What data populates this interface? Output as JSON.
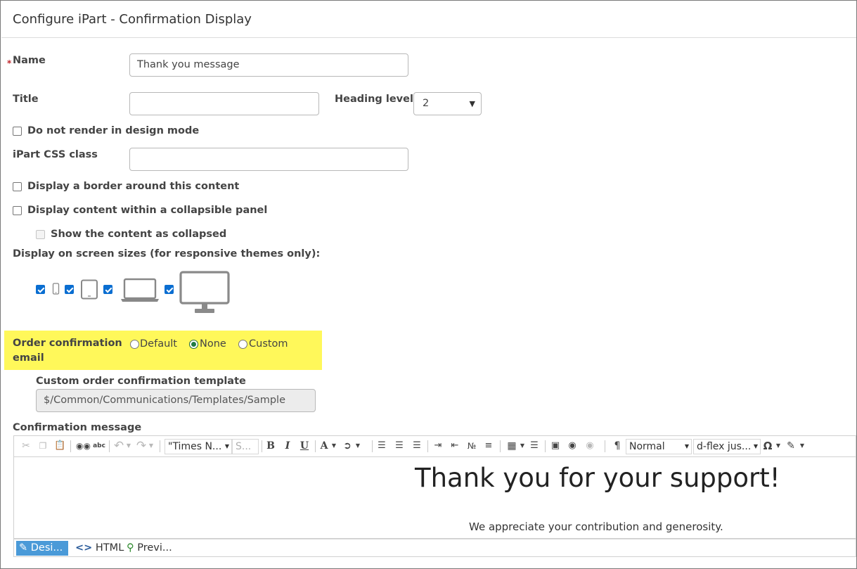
{
  "window": {
    "title": "Configure iPart - Confirmation Display"
  },
  "form": {
    "name": {
      "required_mark": "*",
      "label": "Name",
      "value": "Thank you message"
    },
    "title": {
      "label": "Title",
      "value": ""
    },
    "heading_level": {
      "label": "Heading level",
      "value": "2"
    },
    "no_render_design": {
      "label": "Do not render in design mode",
      "checked": false
    },
    "css_class": {
      "label": "iPart CSS class",
      "value": ""
    },
    "display_border": {
      "label": "Display a border around this content",
      "checked": false
    },
    "collapsible": {
      "label": "Display content within a collapsible panel",
      "checked": false
    },
    "show_collapsed": {
      "label": "Show the content as collapsed",
      "checked": false,
      "disabled": true
    },
    "screen_sizes": {
      "label": "Display on screen sizes (for responsive themes only):",
      "devices": [
        {
          "name": "phone",
          "checked": true
        },
        {
          "name": "tablet",
          "checked": true
        },
        {
          "name": "laptop",
          "checked": true
        },
        {
          "name": "desktop",
          "checked": true
        }
      ]
    },
    "order_email": {
      "label_line1": "Order confirmation",
      "label_line2": "email",
      "options": [
        "Default",
        "None",
        "Custom"
      ],
      "selected": "None",
      "highlight_color": "#fff85a"
    },
    "custom_template": {
      "label": "Custom order confirmation template",
      "value": "$/Common/Communications/Templates/Sample"
    },
    "confirmation_message": {
      "label": "Confirmation message"
    }
  },
  "editor": {
    "toolbar": {
      "font_name": "\"Times N...",
      "font_size": "S...",
      "format": "Normal",
      "class": "d-flex jus..."
    },
    "content": {
      "heading": "Thank you for your support!",
      "paragraph": "We appreciate your contribution and generosity."
    },
    "modes": [
      "Desi...",
      "HTML",
      "Previ..."
    ],
    "active_mode": "Desi..."
  },
  "colors": {
    "accent": "#0a6ed1",
    "radio_selected": "#1e7a45",
    "mode_active": "#4a9ad8",
    "required": "#c0282d"
  }
}
